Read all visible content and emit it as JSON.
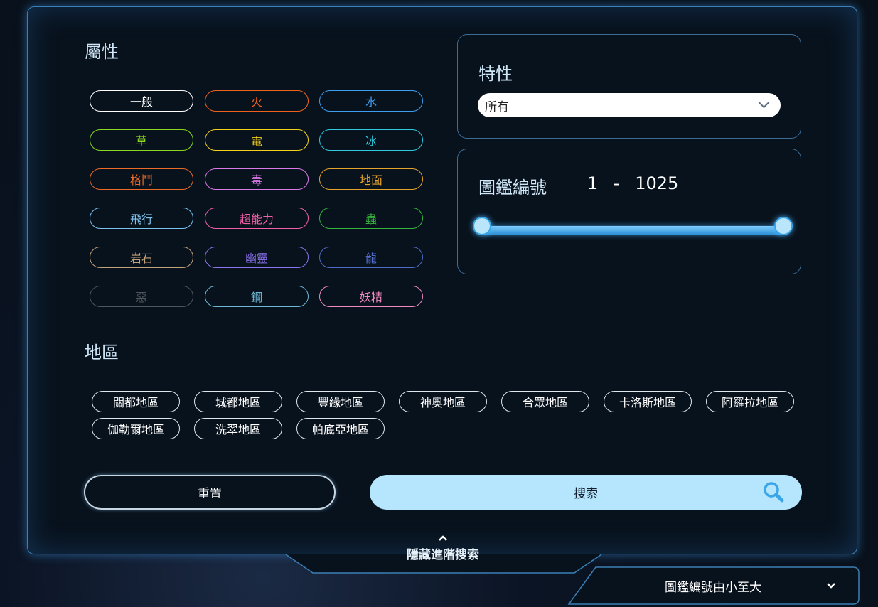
{
  "types": {
    "title": "屬性",
    "items": [
      {
        "label": "一般",
        "color": "#ffffff"
      },
      {
        "label": "火",
        "color": "#f0621c"
      },
      {
        "label": "水",
        "color": "#3e9ff0"
      },
      {
        "label": "草",
        "color": "#8bd61e"
      },
      {
        "label": "電",
        "color": "#f5d21a"
      },
      {
        "label": "冰",
        "color": "#2fcbe0"
      },
      {
        "label": "格鬥",
        "color": "#ec6a27"
      },
      {
        "label": "毒",
        "color": "#d979e6"
      },
      {
        "label": "地面",
        "color": "#e6a42a"
      },
      {
        "label": "飛行",
        "color": "#7dc3ef"
      },
      {
        "label": "超能力",
        "color": "#f25fa8"
      },
      {
        "label": "蟲",
        "color": "#38b53f"
      },
      {
        "label": "岩石",
        "color": "#c3a37a"
      },
      {
        "label": "幽靈",
        "color": "#8c73ef"
      },
      {
        "label": "龍",
        "color": "#506cc8"
      },
      {
        "label": "惡",
        "color": "#50555c"
      },
      {
        "label": "鋼",
        "color": "#6fb8d6"
      },
      {
        "label": "妖精",
        "color": "#f28ac1"
      }
    ]
  },
  "ability": {
    "title": "特性",
    "selected": "所有"
  },
  "dex_range": {
    "title": "圖鑑編號",
    "min": "1",
    "separator": "-",
    "max": "1025"
  },
  "regions": {
    "title": "地區",
    "items": [
      "關都地區",
      "城都地區",
      "豐緣地區",
      "神奧地區",
      "合眾地區",
      "卡洛斯地區",
      "阿羅拉地區",
      "伽勒爾地區",
      "洗翠地區",
      "帕底亞地區"
    ]
  },
  "actions": {
    "reset_label": "重置",
    "search_label": "搜索"
  },
  "toggle": {
    "label": "隱藏進階搜索"
  },
  "sort": {
    "label": "圖鑑編號由小至大"
  },
  "colors": {
    "accent": "#3aa6e8",
    "search_bg": "#b6e6fd"
  }
}
